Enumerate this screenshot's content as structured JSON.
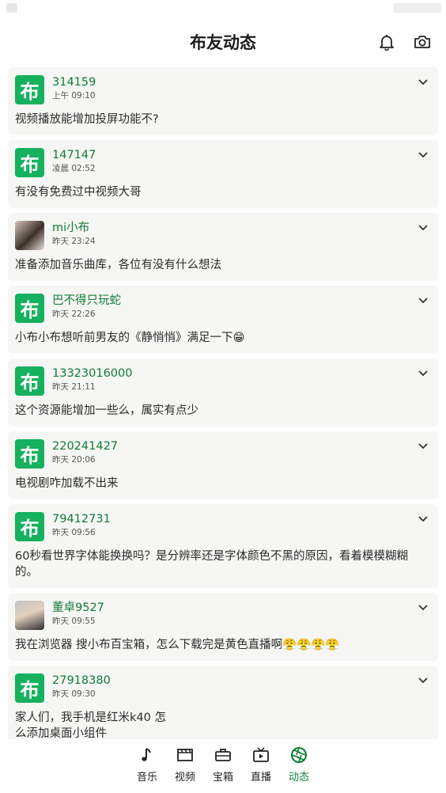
{
  "header": {
    "title": "布友动态"
  },
  "colors": {
    "accent": "#16b15e",
    "name_green": "#0f7a35"
  },
  "posts": [
    {
      "user": "314159",
      "time": "上午 09:10",
      "text": "视频播放能增加投屏功能不?",
      "avatar": "logo"
    },
    {
      "user": "147147",
      "time": "凌晨 02:52",
      "text": "有没有免费过中视频大哥",
      "avatar": "logo"
    },
    {
      "user": "mi小布",
      "time": "昨天 23:24",
      "text": "准备添加音乐曲库，各位有没有什么想法",
      "avatar": "photo-girl"
    },
    {
      "user": "巴不得只玩蛇",
      "time": "昨天 22:26",
      "text": "小布小布想听前男友的《静悄悄》满足一下😁",
      "avatar": "logo"
    },
    {
      "user": "13323016000",
      "time": "昨天 21:11",
      "text": "这个资源能增加一些么，属实有点少",
      "avatar": "logo"
    },
    {
      "user": "220241427",
      "time": "昨天 20:06",
      "text": "电视剧咋加载不出来",
      "avatar": "logo"
    },
    {
      "user": "79412731",
      "time": "昨天 09:56",
      "text": "60秒看世界字体能换换吗？是分辨率还是字体颜色不黑的原因，看着模模糊糊的。",
      "avatar": "logo"
    },
    {
      "user": "董卓9527",
      "time": "昨天 09:55",
      "text": "我在浏览器 搜小布百宝箱，怎么下载完是黄色直播啊😤😤😤😤",
      "avatar": "photo-man"
    },
    {
      "user": "27918380",
      "time": "昨天 09:30",
      "text": "家人们，我手机是红米k40 怎么添加桌面小组件",
      "avatar": "logo"
    }
  ],
  "avatar_logo_char": "布",
  "tabs": [
    {
      "label": "音乐",
      "icon": "music-note-icon"
    },
    {
      "label": "视频",
      "icon": "film-icon"
    },
    {
      "label": "宝箱",
      "icon": "toolbox-icon"
    },
    {
      "label": "直播",
      "icon": "tv-play-icon"
    },
    {
      "label": "动态",
      "icon": "aperture-icon",
      "active": true
    }
  ]
}
